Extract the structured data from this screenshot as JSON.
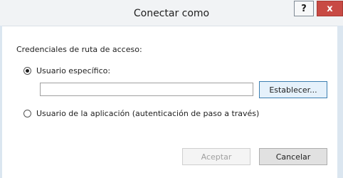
{
  "window": {
    "title": "Conectar como",
    "help_label": "?",
    "close_label": "x"
  },
  "credentials": {
    "section_label": "Credenciales de ruta de acceso:",
    "specific_user": {
      "label": "Usuario específico:",
      "selected": true,
      "path_value": "",
      "set_button": "Establecer..."
    },
    "app_user": {
      "label": "Usuario de la aplicación (autenticación de paso a través)",
      "selected": false
    }
  },
  "footer": {
    "accept_label": "Aceptar",
    "accept_enabled": false,
    "cancel_label": "Cancelar"
  },
  "colors": {
    "close_button": "#c84a44",
    "focused_button_border": "#3c7fb1",
    "side_accent": "#dbe6f0"
  }
}
